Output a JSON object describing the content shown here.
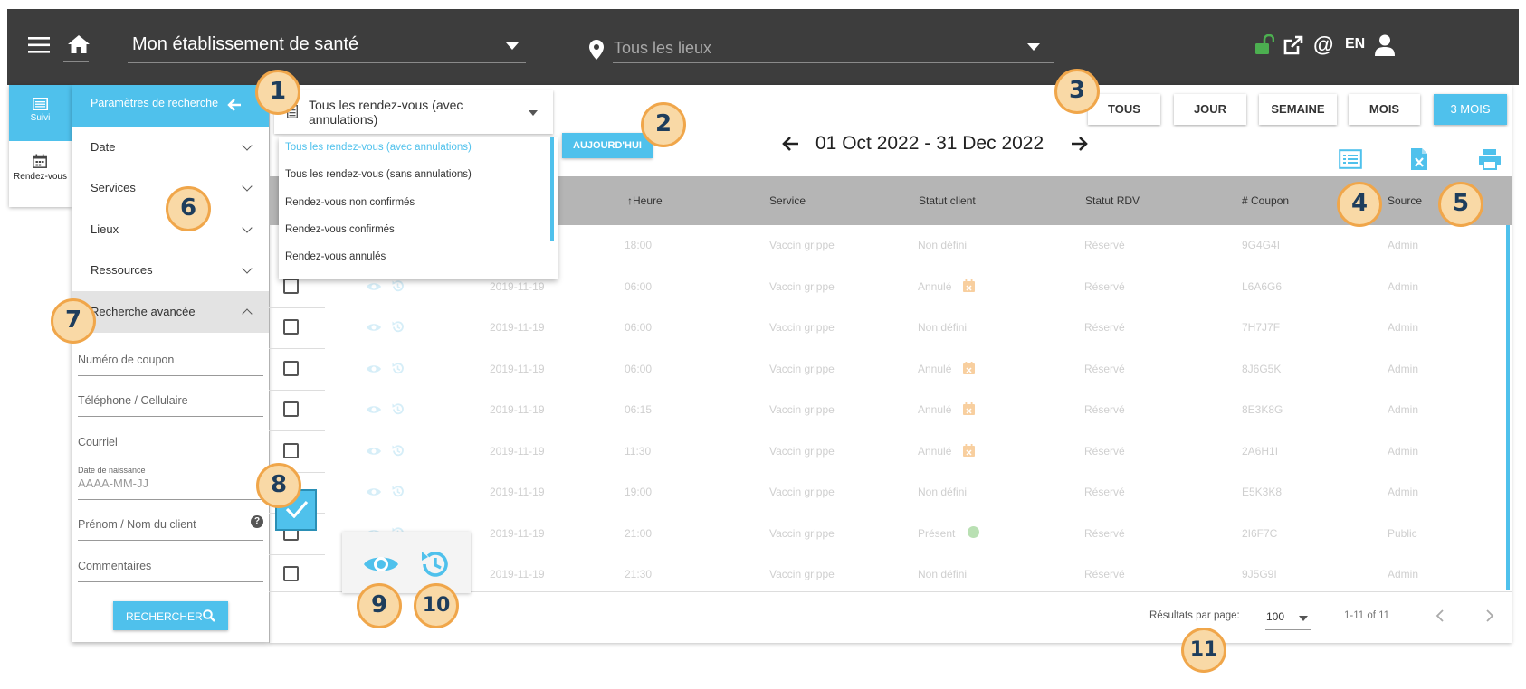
{
  "topbar": {
    "establishment": "Mon établissement de santé",
    "location_placeholder": "Tous les lieux",
    "language": "EN"
  },
  "rail": {
    "items": [
      {
        "label": "Suivi"
      },
      {
        "label": "Rendez-vous"
      }
    ]
  },
  "search_panel": {
    "header": "Paramètres de recherche",
    "sections": [
      {
        "label": "Date"
      },
      {
        "label": "Services"
      },
      {
        "label": "Lieux"
      },
      {
        "label": "Ressources"
      },
      {
        "label": "Recherche avancée"
      }
    ],
    "fields": {
      "coupon": "Numéro de coupon",
      "phone": "Téléphone / Cellulaire",
      "email": "Courriel",
      "birth_label": "Date de naissance",
      "birth_placeholder": "AAAA-MM-JJ",
      "name": "Prénom / Nom du client",
      "comments": "Commentaires"
    },
    "search_button": "RECHERCHER"
  },
  "filter_select": {
    "value": "Tous les rendez-vous (avec annulations)",
    "value_line1": "Tous les rendez-vous (avec",
    "value_line2": "annulations)",
    "options": [
      "Tous les rendez-vous (avec annulations)",
      "Tous les rendez-vous (sans annulations)",
      "Rendez-vous non confirmés",
      "Rendez-vous confirmés",
      "Rendez-vous annulés"
    ]
  },
  "toolbar": {
    "today_button": "AUJOURD'HUI",
    "date_range": "01 Oct 2022 - 31 Dec 2022",
    "views": [
      "TOUS",
      "JOUR",
      "SEMAINE",
      "MOIS",
      "3 MOIS"
    ],
    "active_view": "3 MOIS"
  },
  "table": {
    "columns": {
      "time": "Heure",
      "service": "Service",
      "client_status": "Statut client",
      "appt_status": "Statut RDV",
      "coupon": "# Coupon",
      "source": "Source"
    },
    "rows": [
      {
        "date": "",
        "time": "18:00",
        "service": "Vaccin grippe",
        "client_status": "Non défini",
        "appt_status": "Réservé",
        "coupon": "9G4G4I",
        "source": "Admin"
      },
      {
        "date": "2019-11-19",
        "time": "06:00",
        "service": "Vaccin grippe",
        "client_status": "Annulé",
        "appt_status": "Réservé",
        "coupon": "L6A6G6",
        "source": "Admin"
      },
      {
        "date": "2019-11-19",
        "time": "06:00",
        "service": "Vaccin grippe",
        "client_status": "Non défini",
        "appt_status": "Réservé",
        "coupon": "7H7J7F",
        "source": "Admin"
      },
      {
        "date": "2019-11-19",
        "time": "06:00",
        "service": "Vaccin grippe",
        "client_status": "Annulé",
        "appt_status": "Réservé",
        "coupon": "8J6G5K",
        "source": "Admin"
      },
      {
        "date": "2019-11-19",
        "time": "06:15",
        "service": "Vaccin grippe",
        "client_status": "Annulé",
        "appt_status": "Réservé",
        "coupon": "8E3K8G",
        "source": "Admin"
      },
      {
        "date": "2019-11-19",
        "time": "11:30",
        "service": "Vaccin grippe",
        "client_status": "Annulé",
        "appt_status": "Réservé",
        "coupon": "2A6H1I",
        "source": "Admin"
      },
      {
        "date": "2019-11-19",
        "time": "19:00",
        "service": "Vaccin grippe",
        "client_status": "Non défini",
        "appt_status": "Réservé",
        "coupon": "E5K3K8",
        "source": "Admin"
      },
      {
        "date": "2019-11-19",
        "time": "21:00",
        "service": "Vaccin grippe",
        "client_status": "Présent",
        "appt_status": "Réservé",
        "coupon": "2I6F7C",
        "source": "Public"
      },
      {
        "date": "2019-11-19",
        "time": "21:30",
        "service": "Vaccin grippe",
        "client_status": "Non défini",
        "appt_status": "Réservé",
        "coupon": "9J5G9I",
        "source": "Admin"
      }
    ]
  },
  "pagination": {
    "label": "Résultats par page:",
    "per_page": "100",
    "range": "1-11 of 11"
  },
  "callouts": [
    "1",
    "2",
    "3",
    "4",
    "5",
    "6",
    "7",
    "8",
    "9",
    "10",
    "11"
  ],
  "colors": {
    "topbar": "#3d3d3d",
    "accent": "#4fc1ec",
    "callout_fill": "#f9d9a6",
    "callout_border": "#f0a64a",
    "callout_text": "#1e3d5c",
    "lock_green": "#4caf50",
    "cancel_orange": "#f5b26b"
  },
  "icons": [
    "menu-icon",
    "home-icon",
    "location-pin-icon",
    "unlock-icon",
    "external-link-icon",
    "at-icon",
    "user-icon",
    "list-view-icon",
    "excel-icon",
    "print-icon",
    "eye-icon",
    "history-icon",
    "calendar-icon",
    "search-icon"
  ]
}
